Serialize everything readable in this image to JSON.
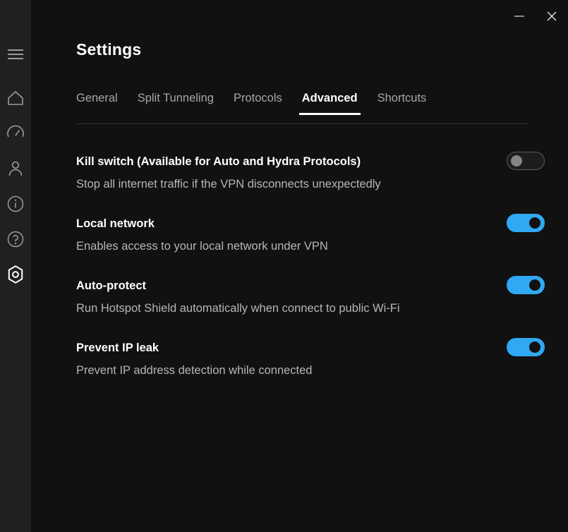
{
  "window": {
    "minimize_label": "Minimize",
    "close_label": "Close"
  },
  "sidebar": {
    "items": [
      {
        "name": "menu",
        "icon": "hamburger-icon",
        "active": false
      },
      {
        "name": "home",
        "icon": "home-icon",
        "active": false
      },
      {
        "name": "speed",
        "icon": "speedometer-icon",
        "active": false
      },
      {
        "name": "account",
        "icon": "person-icon",
        "active": false
      },
      {
        "name": "info",
        "icon": "info-circle-icon",
        "active": false
      },
      {
        "name": "help",
        "icon": "question-circle-icon",
        "active": false
      },
      {
        "name": "settings",
        "icon": "gear-hexagon-icon",
        "active": true
      }
    ]
  },
  "header": {
    "title": "Settings"
  },
  "tabs": [
    {
      "label": "General",
      "active": false
    },
    {
      "label": "Split Tunneling",
      "active": false
    },
    {
      "label": "Protocols",
      "active": false
    },
    {
      "label": "Advanced",
      "active": true
    },
    {
      "label": "Shortcuts",
      "active": false
    }
  ],
  "settings": [
    {
      "title": "Kill switch (Available for Auto and Hydra Protocols)",
      "description": "Stop all internet traffic if the VPN disconnects unexpectedly",
      "enabled": false
    },
    {
      "title": "Local network",
      "description": "Enables access to your local network under VPN",
      "enabled": true
    },
    {
      "title": "Auto-protect",
      "description": "Run Hotspot Shield automatically when connect to public Wi-Fi",
      "enabled": true
    },
    {
      "title": "Prevent IP leak",
      "description": "Prevent IP address detection while connected",
      "enabled": true
    }
  ],
  "colors": {
    "accent": "#30a8f3",
    "sidebar_bg": "#202020",
    "main_bg": "#111111",
    "title_text": "#ffffff",
    "desc_text": "#b6b6b6",
    "inactive_tab": "#a6a6a6"
  }
}
